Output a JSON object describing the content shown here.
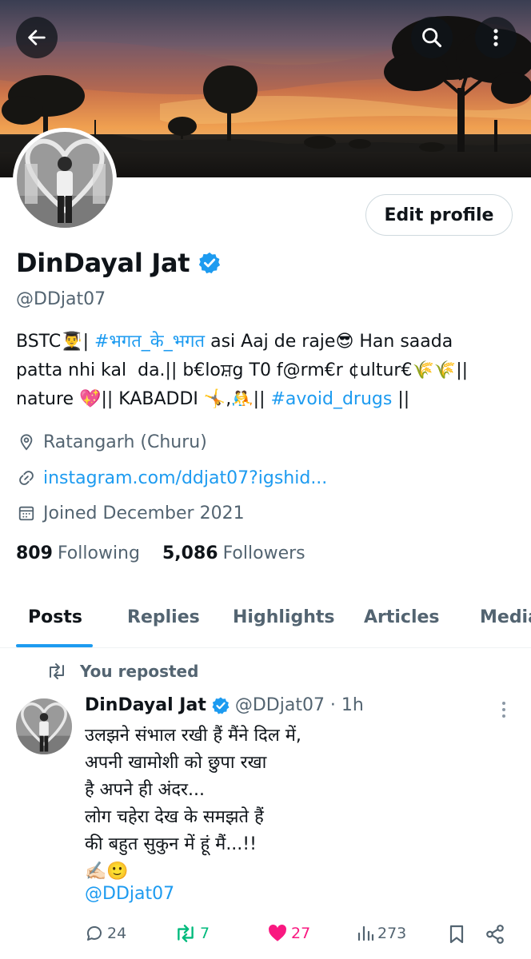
{
  "header": {
    "back_icon": "arrow-left-icon",
    "search_icon": "search-icon",
    "more_icon": "more-vertical-icon"
  },
  "profile": {
    "edit_label": "Edit profile",
    "display_name": "DinDayal Jat",
    "handle": "@DDjat07",
    "bio": {
      "line1_a": "BSTC👨‍🎓| ",
      "line1_tag": "#भगत_के_भगत",
      "line1_b": " asi Aaj de raje😎 Han saada",
      "line2": "patta nhi kal  da.|| b€loਸ਼g T0 f@rm€r ¢ultur€🌾🌾||",
      "line3_a": "nature 💖|| KABADDI 🤸,🤼|| ",
      "line3_tag": "#avoid_drugs",
      "line3_b": " ||"
    },
    "location": "Ratangarh (Churu)",
    "website": "instagram.com/ddjat07?igshid...",
    "joined": "Joined December 2021",
    "following_count": "809",
    "following_label": "Following",
    "followers_count": "5,086",
    "followers_label": "Followers"
  },
  "tabs": [
    "Posts",
    "Replies",
    "Highlights",
    "Articles",
    "Media"
  ],
  "post": {
    "repost_label": "You reposted",
    "author": "DinDayal Jat",
    "handle_time": "@DDjat07 · 1h",
    "text": "उलझने संभाल रखी हैं मैंने दिल में,\nअपनी खामोशी को छुपा रखा\nहै अपने ही अंदर...\nलोग चहेरा देख के समझते हैं\nकी बहुत सुकुन में हूं मैं...!!\n✍🏻🙂",
    "mention": "@DDjat07",
    "replies": "24",
    "reposts": "7",
    "likes": "27",
    "views": "273"
  },
  "colors": {
    "accent": "#1d9bf0",
    "verified": "#1d9bf0",
    "repost_active": "#00ba7c",
    "like_active": "#f91880",
    "secondary_text": "#536471"
  }
}
